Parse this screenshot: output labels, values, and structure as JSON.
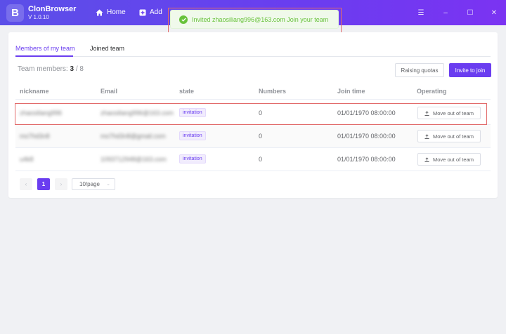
{
  "app": {
    "name": "ClonBrowser",
    "version": "V 1.0.10",
    "logo_letter": "B"
  },
  "nav": {
    "home_label": "Home",
    "add_label": "Add"
  },
  "window_controls": {
    "menu": "☰",
    "minimize": "–",
    "maximize": "☐",
    "close": "✕"
  },
  "toast": {
    "message": "Invited zhaosiliang996@163.com Join your team",
    "color": "#67c23a"
  },
  "tabs": [
    {
      "label": "Members of my team",
      "active": true
    },
    {
      "label": "Joined team",
      "active": false
    }
  ],
  "team_members": {
    "label": "Team members:",
    "count": "3",
    "separator": "/",
    "max": "8"
  },
  "buttons": {
    "raising_quotas": "Raising quotas",
    "invite_to_join": "Invite to join"
  },
  "table": {
    "headers": [
      "nickname",
      "Email",
      "state",
      "Numbers",
      "Join time",
      "Operating"
    ],
    "rows": [
      {
        "nickname": "zhaosiliang996",
        "email": "zhaosiliang996@163.com",
        "state": "invitation",
        "numbers": "0",
        "join_time": "01/01/1970 08:00:00",
        "action": "Move out of team"
      },
      {
        "nickname": "mo7hd3n8",
        "email": "mo7hd3n8@gmail.com",
        "state": "invitation",
        "numbers": "0",
        "join_time": "01/01/1970 08:00:00",
        "action": "Move out of team"
      },
      {
        "nickname": "u4k8",
        "email": "1093712948@163.com",
        "state": "invitation",
        "numbers": "0",
        "join_time": "01/01/1970 08:00:00",
        "action": "Move out of team"
      }
    ]
  },
  "pagination": {
    "prev": "‹",
    "current_page": "1",
    "next": "›",
    "page_size": "10/page",
    "size_chevron": "⌄"
  },
  "colors": {
    "accent": "#6a3df0",
    "success": "#67c23a",
    "highlight": "#e26b6b"
  }
}
